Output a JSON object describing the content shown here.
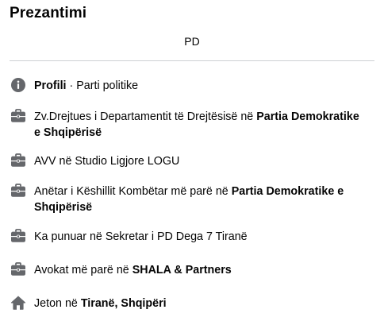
{
  "intro": {
    "title": "Prezantimi",
    "bio": "PD"
  },
  "items": [
    {
      "icon": "info-icon",
      "bold1": "Profili",
      "rest1": " · Parti politike"
    },
    {
      "icon": "briefcase-icon",
      "pre": "Zv.Drejtues i Departamentit të Drejtësisë në ",
      "org": "Partia Demokratike",
      "org2": "e Shqipërisë"
    },
    {
      "icon": "briefcase-icon",
      "text": "AVV në Studio Ligjore LOGU"
    },
    {
      "icon": "briefcase-icon",
      "pre": "Anëtar i Këshillit Kombëtar më parë në ",
      "org": "Partia Demokratike e",
      "org2": "Shqipërisë"
    },
    {
      "icon": "briefcase-icon",
      "text": "Ka punuar në Sekretar i PD Dega 7 Tiranë"
    },
    {
      "icon": "briefcase-icon",
      "pre": "Avokat më parë në ",
      "org": "SHALA & Partners"
    },
    {
      "icon": "home-icon",
      "pre": "Jeton në ",
      "org": "Tiranë, Shqipëri"
    }
  ],
  "colors": {
    "icon": "#65676b",
    "divider": "#ced0d4",
    "text": "#050505"
  }
}
